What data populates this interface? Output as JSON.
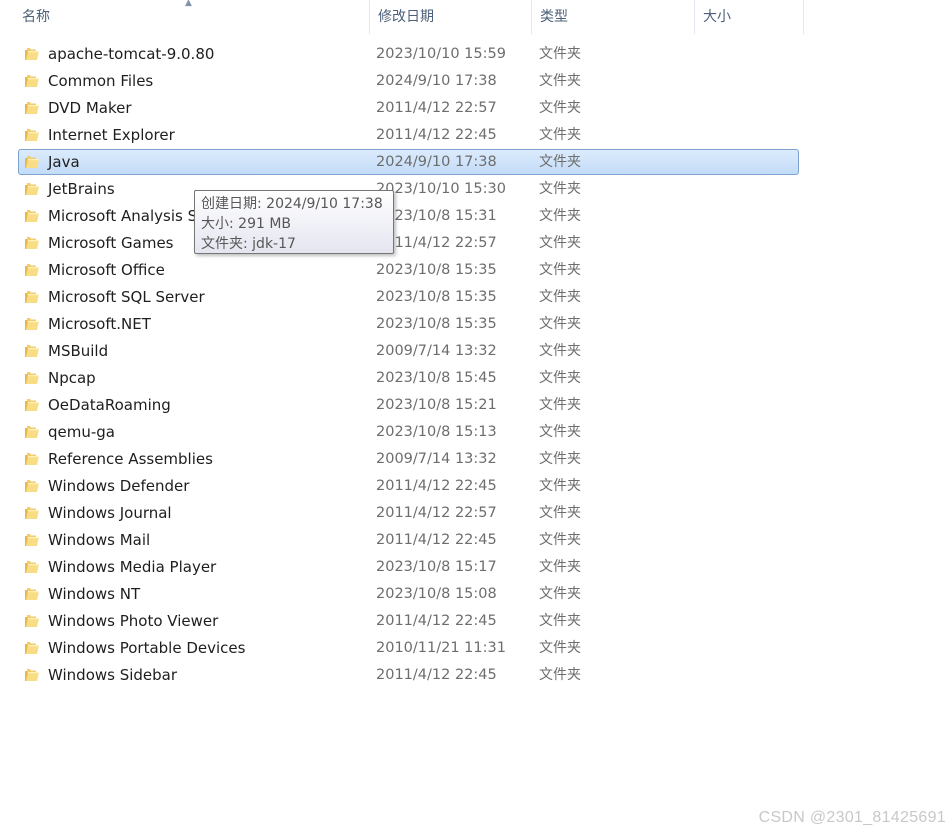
{
  "columns": {
    "name": "名称",
    "date": "修改日期",
    "type": "类型",
    "size": "大小"
  },
  "sort_indicator": "^",
  "folder_icon": "folder-icon",
  "colors": {
    "folder_yellow": "#f5d36b",
    "selection_border": "#7da2ce",
    "selection_fill": "#cfe3fb"
  },
  "files": [
    {
      "name": "apache-tomcat-9.0.80",
      "date": "2023/10/10 15:59",
      "type": "文件夹"
    },
    {
      "name": "Common Files",
      "date": "2024/9/10 17:38",
      "type": "文件夹"
    },
    {
      "name": "DVD Maker",
      "date": "2011/4/12 22:57",
      "type": "文件夹"
    },
    {
      "name": "Internet Explorer",
      "date": "2011/4/12 22:45",
      "type": "文件夹"
    },
    {
      "name": "Java",
      "date": "2024/9/10 17:38",
      "type": "文件夹",
      "selected": true
    },
    {
      "name": "JetBrains",
      "date": "2023/10/10 15:30",
      "type": "文件夹"
    },
    {
      "name": "Microsoft Analysis Services",
      "date": "2023/10/8 15:31",
      "type": "文件夹"
    },
    {
      "name": "Microsoft Games",
      "date": "2011/4/12 22:57",
      "type": "文件夹"
    },
    {
      "name": "Microsoft Office",
      "date": "2023/10/8 15:35",
      "type": "文件夹"
    },
    {
      "name": "Microsoft SQL Server",
      "date": "2023/10/8 15:35",
      "type": "文件夹"
    },
    {
      "name": "Microsoft.NET",
      "date": "2023/10/8 15:35",
      "type": "文件夹"
    },
    {
      "name": "MSBuild",
      "date": "2009/7/14 13:32",
      "type": "文件夹"
    },
    {
      "name": "Npcap",
      "date": "2023/10/8 15:45",
      "type": "文件夹"
    },
    {
      "name": "OeDataRoaming",
      "date": "2023/10/8 15:21",
      "type": "文件夹"
    },
    {
      "name": "qemu-ga",
      "date": "2023/10/8 15:13",
      "type": "文件夹"
    },
    {
      "name": "Reference Assemblies",
      "date": "2009/7/14 13:32",
      "type": "文件夹"
    },
    {
      "name": "Windows Defender",
      "date": "2011/4/12 22:45",
      "type": "文件夹"
    },
    {
      "name": "Windows Journal",
      "date": "2011/4/12 22:57",
      "type": "文件夹"
    },
    {
      "name": "Windows Mail",
      "date": "2011/4/12 22:45",
      "type": "文件夹"
    },
    {
      "name": "Windows Media Player",
      "date": "2023/10/8 15:17",
      "type": "文件夹"
    },
    {
      "name": "Windows NT",
      "date": "2023/10/8 15:08",
      "type": "文件夹"
    },
    {
      "name": "Windows Photo Viewer",
      "date": "2011/4/12 22:45",
      "type": "文件夹"
    },
    {
      "name": "Windows Portable Devices",
      "date": "2010/11/21 11:31",
      "type": "文件夹"
    },
    {
      "name": "Windows Sidebar",
      "date": "2011/4/12 22:45",
      "type": "文件夹"
    }
  ],
  "tooltip": {
    "created": "创建日期: 2024/9/10 17:38",
    "size": "大小: 291 MB",
    "folder": "文件夹: jdk-17"
  },
  "watermark": "CSDN @2301_81425691"
}
